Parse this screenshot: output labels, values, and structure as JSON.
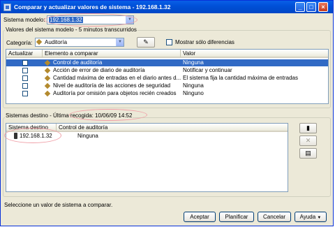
{
  "window": {
    "title": "Comparar y actualizar valores de sistema - 192.168.1.32"
  },
  "model": {
    "label": "Sistema modelo:",
    "value": "192.168.1.32"
  },
  "values_group": {
    "legend": "Valores del sistema modelo - 5 minutos transcurridos"
  },
  "category": {
    "label": "Categoría:",
    "value": "Auditoría"
  },
  "show_diff_label": "Mostrar sólo diferencias",
  "values_table": {
    "columns": [
      "Actualizar",
      "Elemento a comparar",
      "Valor"
    ],
    "rows": [
      {
        "element": "Control de auditoría",
        "value": "Ninguna",
        "selected": true
      },
      {
        "element": "Acción de error de diario de auditoría",
        "value": "Notificar y continuar"
      },
      {
        "element": "Cantidad máxima de entradas en el diario antes d...",
        "value": "El sistema fija la cantidad máxima de entradas"
      },
      {
        "element": "Nivel de auditoría de las acciones de seguridad",
        "value": "Ninguna"
      },
      {
        "element": "Auditoría por omisión para objetos recién creados",
        "value": "Ninguno"
      }
    ]
  },
  "targets_group": {
    "legend": "Sistemas destino - Última recogida: 10/06/09 14:52"
  },
  "targets_table": {
    "columns": [
      "Sistema destino",
      "Control de auditoría"
    ],
    "rows": [
      {
        "system": "192.168.1.32",
        "value": "Ninguna"
      }
    ]
  },
  "status_text": "Seleccione un valor de sistema a comparar.",
  "buttons": {
    "accept": "Aceptar",
    "plan": "Planificar",
    "cancel": "Cancelar",
    "help": "Ayuda"
  },
  "colors": {
    "selection": "#316ac5",
    "titlebar": "#0050d8",
    "annotation": "#f0a0a8"
  }
}
